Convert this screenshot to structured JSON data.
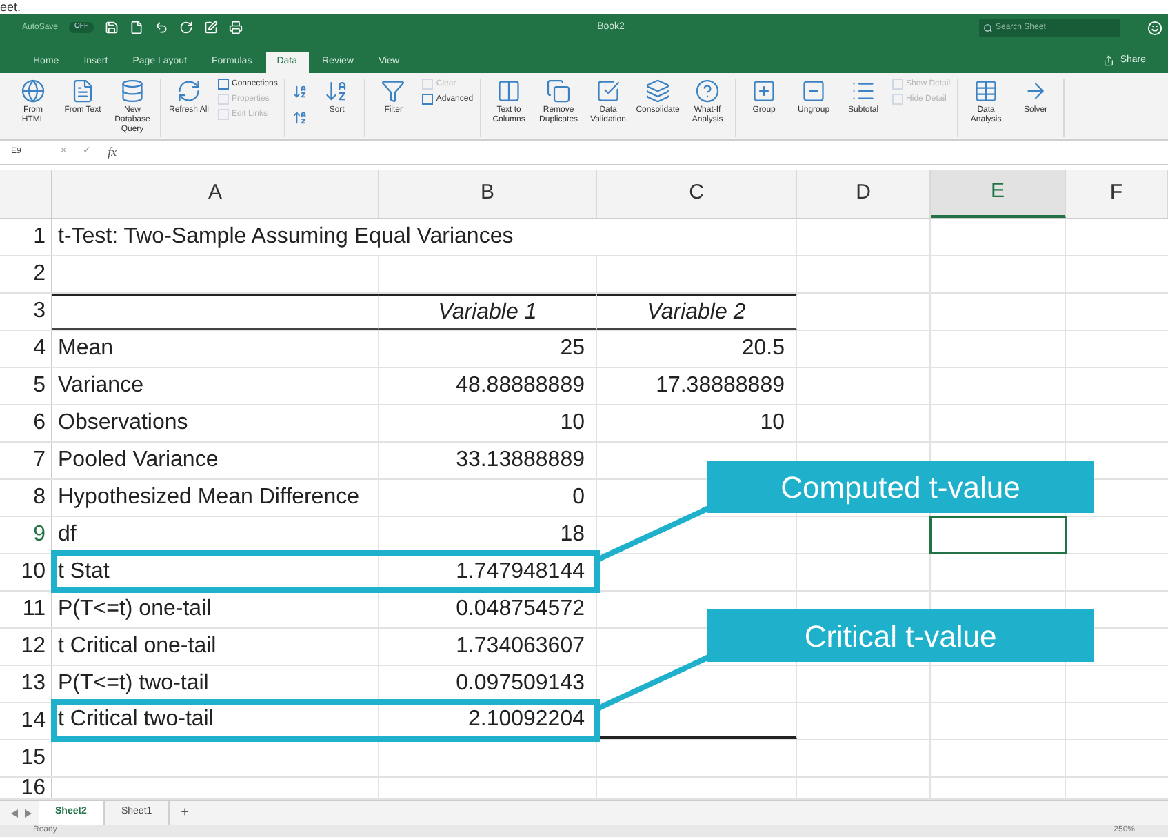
{
  "page_caption": "eet.",
  "title_bar": {
    "autosave_label": "AutoSave",
    "autosave_state": "OFF",
    "title": "Book2",
    "search": {
      "placeholder": "Search Sheet"
    }
  },
  "tabs": [
    {
      "label": "Home",
      "selected": false
    },
    {
      "label": "Insert",
      "selected": false
    },
    {
      "label": "Page Layout",
      "selected": false
    },
    {
      "label": "Formulas",
      "selected": false
    },
    {
      "label": "Data",
      "selected": true
    },
    {
      "label": "Review",
      "selected": false
    },
    {
      "label": "View",
      "selected": false
    }
  ],
  "share_button": "Share",
  "ribbon": [
    {
      "items": [
        {
          "kind": "large",
          "label": "From HTML"
        },
        {
          "kind": "large",
          "label": "From Text"
        },
        {
          "kind": "large",
          "label": "New Database Query"
        }
      ]
    },
    {
      "items": [
        {
          "kind": "large",
          "label": "Refresh All"
        },
        {
          "kind": "stack",
          "entries": [
            {
              "label": "Connections",
              "disabled": false
            },
            {
              "label": "Properties",
              "disabled": true
            },
            {
              "label": "Edit Links",
              "disabled": true
            }
          ]
        }
      ]
    },
    {
      "items": [
        {
          "kind": "sort-pair"
        },
        {
          "kind": "large",
          "label": "Sort"
        }
      ]
    },
    {
      "items": [
        {
          "kind": "large",
          "label": "Filter"
        },
        {
          "kind": "stack",
          "entries": [
            {
              "label": "Clear",
              "disabled": true
            },
            {
              "label": "Advanced",
              "disabled": false
            }
          ]
        }
      ]
    },
    {
      "items": [
        {
          "kind": "large",
          "label": "Text to Columns"
        },
        {
          "kind": "large",
          "label": "Remove Duplicates"
        },
        {
          "kind": "large",
          "label": "Data Validation"
        },
        {
          "kind": "large",
          "label": "Consolidate"
        },
        {
          "kind": "large",
          "label": "What-If Analysis"
        }
      ]
    },
    {
      "items": [
        {
          "kind": "large",
          "label": "Group"
        },
        {
          "kind": "large",
          "label": "Ungroup"
        },
        {
          "kind": "large",
          "label": "Subtotal"
        },
        {
          "kind": "stack",
          "entries": [
            {
              "label": "Show Detail",
              "disabled": true
            },
            {
              "label": "Hide Detail",
              "disabled": true
            }
          ]
        }
      ]
    },
    {
      "items": [
        {
          "kind": "large",
          "label": "Data Analysis"
        },
        {
          "kind": "large",
          "label": "Solver"
        }
      ]
    }
  ],
  "formula_bar": {
    "name_box": "E9",
    "cancel": "×",
    "enter": "✓",
    "fx": "fx"
  },
  "columns": [
    {
      "label": "A",
      "selected": false
    },
    {
      "label": "B",
      "selected": false
    },
    {
      "label": "C",
      "selected": false
    },
    {
      "label": "D",
      "selected": false
    },
    {
      "label": "E",
      "selected": true
    },
    {
      "label": "F",
      "selected": false
    }
  ],
  "rows": [
    {
      "number": "1",
      "kind": "title",
      "cells": [
        "t-Test: Two-Sample Assuming Equal Variances"
      ],
      "selected": false
    },
    {
      "number": "2",
      "kind": "blank",
      "cells": [],
      "selected": false
    },
    {
      "number": "3",
      "kind": "header",
      "cells": [
        "",
        "Variable 1",
        "Variable 2"
      ],
      "selected": false
    },
    {
      "number": "4",
      "kind": "data",
      "cells": [
        "Mean",
        "25",
        "20.5"
      ],
      "selected": false
    },
    {
      "number": "5",
      "kind": "data",
      "cells": [
        "Variance",
        "48.88888889",
        "17.38888889"
      ],
      "selected": false
    },
    {
      "number": "6",
      "kind": "data",
      "cells": [
        "Observations",
        "10",
        "10"
      ],
      "selected": false
    },
    {
      "number": "7",
      "kind": "data",
      "cells": [
        "Pooled Variance",
        "33.13888889"
      ],
      "selected": false
    },
    {
      "number": "8",
      "kind": "data",
      "cells": [
        "Hypothesized Mean Difference",
        "0"
      ],
      "selected": false
    },
    {
      "number": "9",
      "kind": "data",
      "cells": [
        "df",
        "18"
      ],
      "selected": true
    },
    {
      "number": "10",
      "kind": "data",
      "cells": [
        "t Stat",
        "1.747948144"
      ],
      "selected": false,
      "callout": "Computed t-value"
    },
    {
      "number": "11",
      "kind": "data",
      "cells": [
        "P(T<=t) one-tail",
        "0.048754572"
      ],
      "selected": false
    },
    {
      "number": "12",
      "kind": "data",
      "cells": [
        "t Critical one-tail",
        "1.734063607"
      ],
      "selected": false
    },
    {
      "number": "13",
      "kind": "data",
      "cells": [
        "P(T<=t) two-tail",
        "0.097509143"
      ],
      "selected": false
    },
    {
      "number": "14",
      "kind": "last",
      "cells": [
        "t Critical two-tail",
        "2.10092204"
      ],
      "selected": false,
      "callout": "Critical t-value"
    },
    {
      "number": "15",
      "kind": "blank",
      "cells": [],
      "selected": false
    },
    {
      "number": "16",
      "kind": "blank",
      "cells": [],
      "selected": false
    }
  ],
  "sheet_tabs": [
    {
      "label": "Sheet2",
      "selected": true
    },
    {
      "label": "Sheet1",
      "selected": false
    }
  ],
  "add_sheet": "+",
  "status_bar": {
    "status": "Ready",
    "zoom": "250%"
  }
}
